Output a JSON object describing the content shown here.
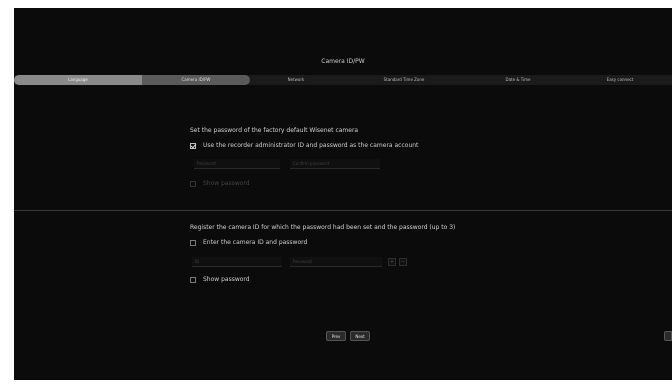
{
  "window": {
    "title": "Camera ID/PW"
  },
  "steps": [
    {
      "label": "Language"
    },
    {
      "label": "Camera ID/PW"
    },
    {
      "label": "Network"
    },
    {
      "label": "Standard Time Zone"
    },
    {
      "label": "Date & Time"
    },
    {
      "label": "Easy connect"
    }
  ],
  "factory": {
    "heading": "Set the password of the factory default Wisenet camera",
    "use_recorder_label": "Use the recorder administrator ID and password as the camera account",
    "use_recorder_checked": true,
    "password_placeholder": "Password",
    "confirm_placeholder": "Confirm password",
    "show_password_label": "Show password"
  },
  "register": {
    "heading": "Register the camera ID for which the password had been set and the password (up to 3)",
    "enter_label": "Enter the camera ID and password",
    "enter_checked": false,
    "id_placeholder": "ID",
    "password_placeholder": "Password",
    "add_symbol": "+",
    "remove_symbol": "−",
    "show_password_label": "Show password",
    "show_password_checked": false
  },
  "footer": {
    "prev_label": "Prev",
    "next_label": "Next"
  }
}
